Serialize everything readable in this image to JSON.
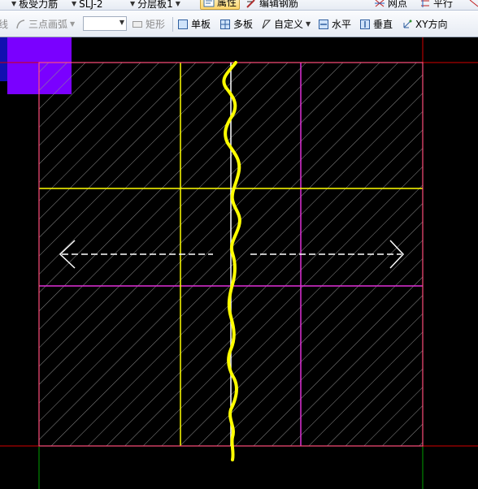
{
  "toolbar_top": {
    "dropdown_rebar": "板受力筋",
    "dropdown_member": "SLJ-2",
    "dropdown_layer": "分层板1",
    "btn_property": "属性",
    "btn_edit_rebar": "编辑钢筋",
    "btn_grid_point": "网点",
    "btn_parallel": "平行"
  },
  "toolbar_draw": {
    "line_tail": "线",
    "arc_label": "三点画弧",
    "combo_value": "",
    "rect_label": "矩形",
    "single_slab": "单板",
    "multi_slab": "多板",
    "custom": "自定义",
    "horizontal": "水平",
    "vertical": "垂直",
    "xy_direction": "XY方向"
  },
  "colors": {
    "background": "#000000",
    "slab_outline": "#ff4e7a",
    "grid_yellow": "#ffff00",
    "grid_magenta": "#e030d8",
    "hatch": "#8c8c8c",
    "axis_red": "#d40000",
    "axis_green": "#00a000",
    "marker_purple": "#7a00ff",
    "marker_blue": "#1010b0",
    "annotation_yellow": "#ffff00",
    "arrow_white": "#ffffff"
  }
}
